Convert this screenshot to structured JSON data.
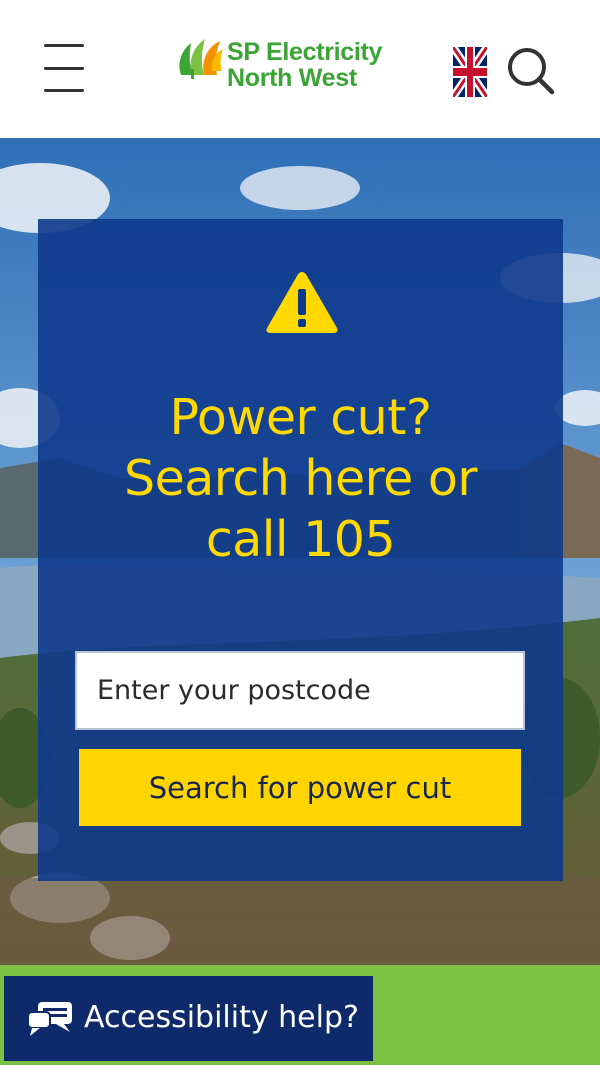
{
  "header": {
    "brand_line1": "SP Electricity",
    "brand_line2": "North West",
    "menu_icon": "hamburger-menu-icon",
    "language_icon": "uk-flag-icon",
    "search_icon": "magnifier-icon"
  },
  "hero": {
    "alert_icon": "warning-triangle-icon",
    "headline_lines": [
      "Power cut?",
      "Search here or",
      "call 105"
    ],
    "postcode_placeholder": "Enter your postcode",
    "postcode_value": "",
    "search_button_label": "Search for power cut"
  },
  "accessibility": {
    "label": "Accessibility help?",
    "icon": "chat-bubbles-icon"
  },
  "colors": {
    "brand_green": "#3aa535",
    "panel_blue": "#0e3a8c",
    "accent_yellow": "#ffd500",
    "footer_green": "#7cc142",
    "accessibility_navy": "#0e2a6b"
  }
}
